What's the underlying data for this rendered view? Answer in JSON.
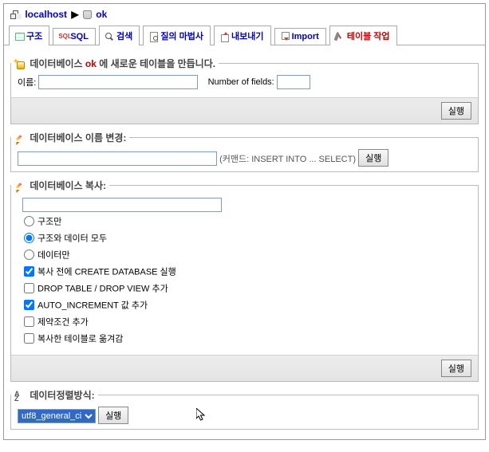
{
  "breadcrumb": {
    "server": "localhost",
    "database": "ok"
  },
  "tabs": {
    "structure": "구조",
    "sql": "SQL",
    "search": "검색",
    "query": "질의 마법사",
    "export": "내보내기",
    "import": "Import",
    "operations": "테이블 작업"
  },
  "create_table": {
    "legend_prefix": "데이터베이스 ",
    "legend_dbname": "ok",
    "legend_suffix": " 에 새로운 테이블을 만듭니다.",
    "name_label": "이름:",
    "fields_label": "Number of fields:",
    "name_value": "",
    "fields_value": "",
    "submit": "실행"
  },
  "rename_db": {
    "legend": "데이터베이스 이름 변경:",
    "value": "",
    "hint": "(커맨드: INSERT INTO ... SELECT)",
    "submit": "실행"
  },
  "copy_db": {
    "legend": "데이터베이스 복사:",
    "target_value": "",
    "opt_structure_only": "구조만",
    "opt_structure_data": "구조와 데이터 모두",
    "opt_data_only": "데이터만",
    "chk_create_db": "복사 전에 CREATE DATABASE 실행",
    "chk_drop": "DROP TABLE / DROP VIEW 추가",
    "chk_autoinc": "AUTO_INCREMENT 값 추가",
    "chk_constraints": "제약조건 추가",
    "chk_switch": "복사한 테이블로 옮겨감",
    "submit": "실행"
  },
  "collation": {
    "legend": "데이터정렬방식:",
    "value": "utf8_general_ci",
    "submit": "실행"
  }
}
